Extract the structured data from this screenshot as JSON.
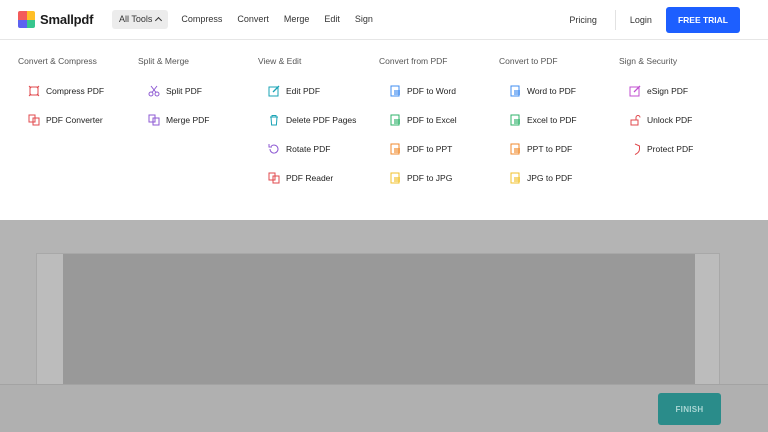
{
  "header": {
    "logo_text": "Smallpdf",
    "nav": [
      "All Tools",
      "Compress",
      "Convert",
      "Merge",
      "Edit",
      "Sign"
    ],
    "pricing": "Pricing",
    "login": "Login",
    "trial": "FREE TRIAL"
  },
  "menu": {
    "columns": [
      {
        "title": "Convert & Compress",
        "items": [
          {
            "label": "Compress PDF",
            "icon": "compress-icon",
            "color": "#e0484c"
          },
          {
            "label": "PDF Converter",
            "icon": "converter-icon",
            "color": "#e0484c"
          }
        ]
      },
      {
        "title": "Split & Merge",
        "items": [
          {
            "label": "Split PDF",
            "icon": "scissors-icon",
            "color": "#8e5ad3"
          },
          {
            "label": "Merge PDF",
            "icon": "merge-icon",
            "color": "#8e5ad3"
          }
        ]
      },
      {
        "title": "View & Edit",
        "items": [
          {
            "label": "Edit PDF",
            "icon": "edit-icon",
            "color": "#1aa3b5"
          },
          {
            "label": "Delete PDF Pages",
            "icon": "trash-icon",
            "color": "#1aa3b5"
          },
          {
            "label": "Rotate PDF",
            "icon": "rotate-icon",
            "color": "#8e5ad3"
          },
          {
            "label": "PDF Reader",
            "icon": "reader-icon",
            "color": "#e0484c"
          }
        ]
      },
      {
        "title": "Convert from PDF",
        "items": [
          {
            "label": "PDF to Word",
            "icon": "word-icon",
            "color": "#3f8cf0"
          },
          {
            "label": "PDF to Excel",
            "icon": "excel-icon",
            "color": "#2fb36a"
          },
          {
            "label": "PDF to PPT",
            "icon": "ppt-icon",
            "color": "#f08a2c"
          },
          {
            "label": "PDF to JPG",
            "icon": "jpg-icon",
            "color": "#f2c12c"
          }
        ]
      },
      {
        "title": "Convert to PDF",
        "items": [
          {
            "label": "Word to PDF",
            "icon": "word-icon",
            "color": "#3f8cf0"
          },
          {
            "label": "Excel to PDF",
            "icon": "excel-icon",
            "color": "#2fb36a"
          },
          {
            "label": "PPT to PDF",
            "icon": "ppt-icon",
            "color": "#f08a2c"
          },
          {
            "label": "JPG to PDF",
            "icon": "jpg-icon",
            "color": "#f2c12c"
          }
        ]
      },
      {
        "title": "Sign & Security",
        "items": [
          {
            "label": "eSign PDF",
            "icon": "esign-icon",
            "color": "#c04fd0"
          },
          {
            "label": "Unlock PDF",
            "icon": "unlock-icon",
            "color": "#e0484c"
          },
          {
            "label": "Protect PDF",
            "icon": "shield-icon",
            "color": "#e0484c"
          }
        ]
      }
    ]
  },
  "footer": {
    "finish": "FINISH"
  }
}
